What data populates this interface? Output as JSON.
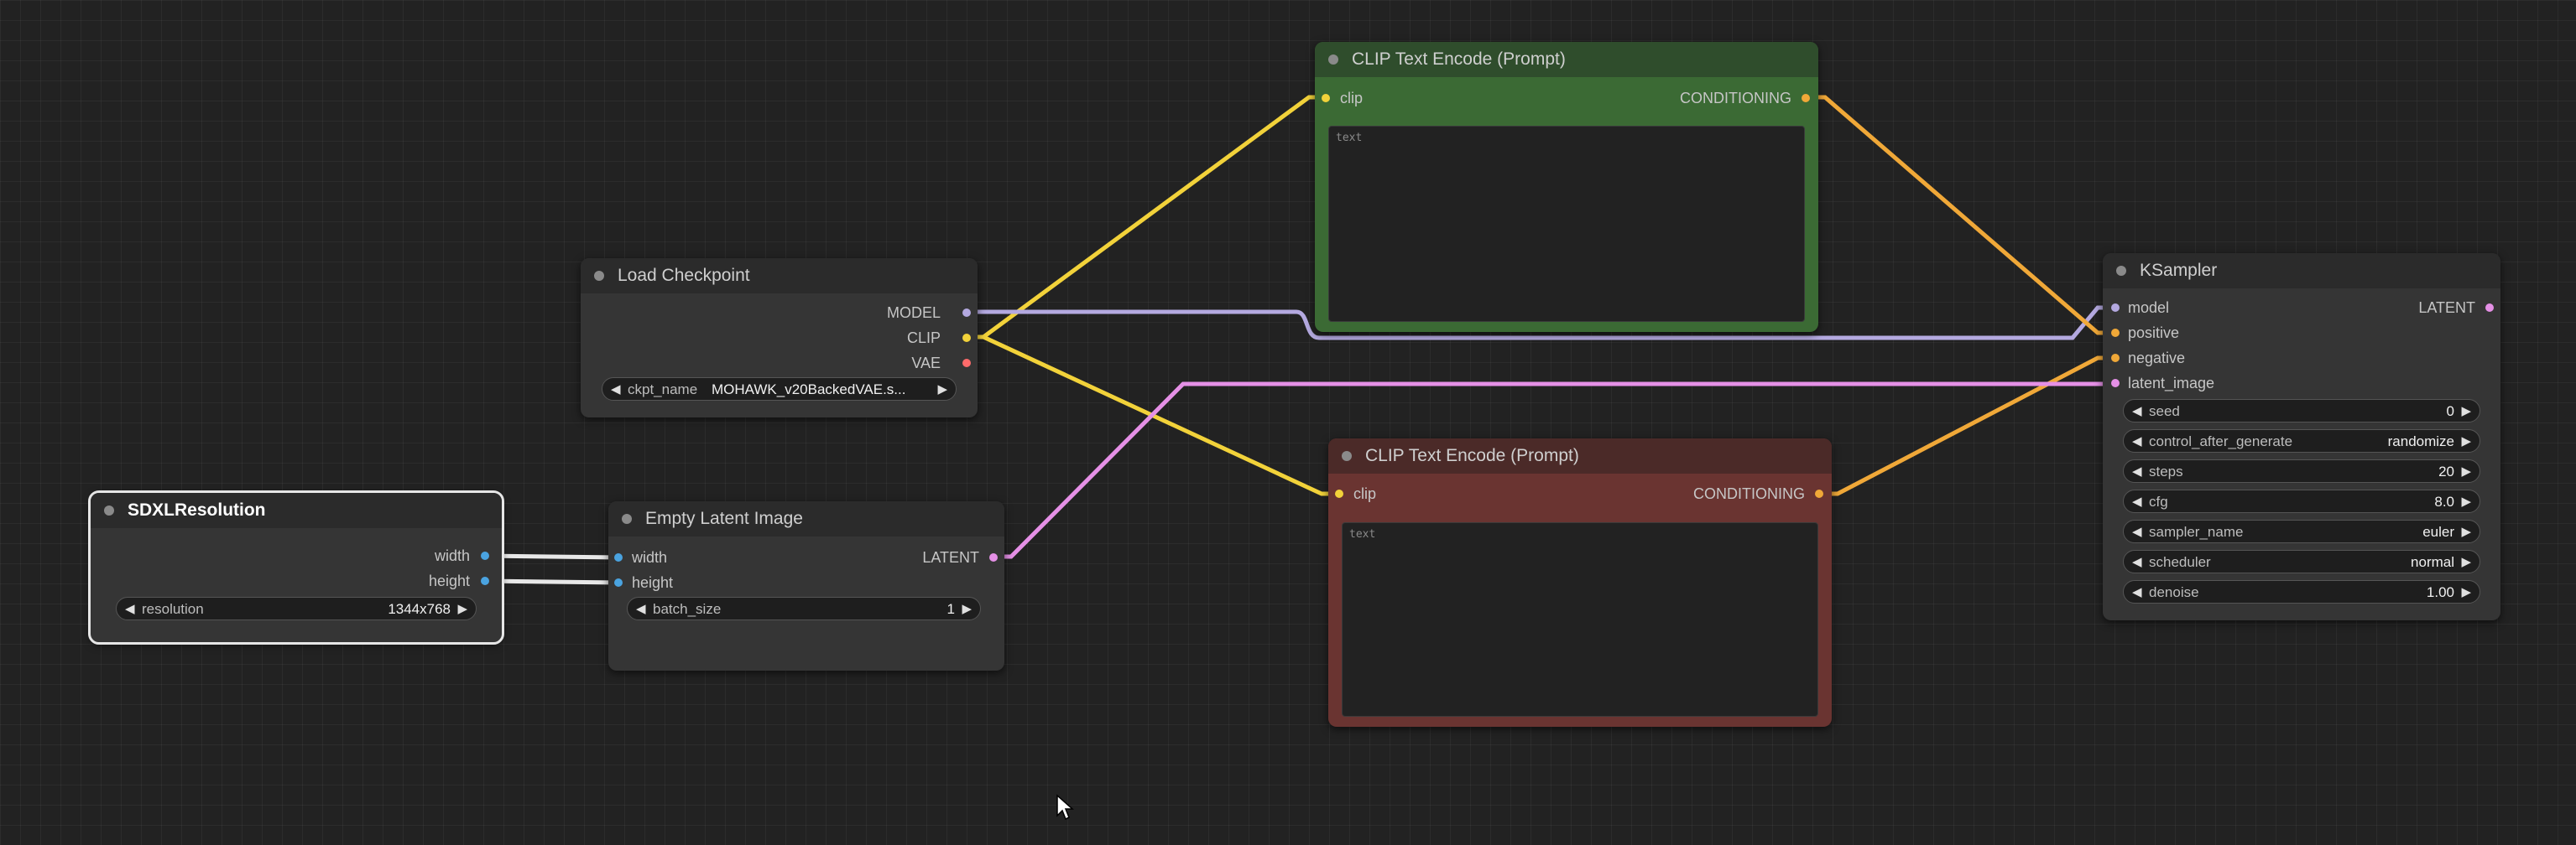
{
  "colors": {
    "model": "#b4a9e0",
    "clip": "#f2d23a",
    "vae": "#ff6b6b",
    "conditioning": "#f0a838",
    "latent": "#e590e6",
    "int": "#4aa3e0",
    "positive_header": "#2f4d2c",
    "positive_body": "#3b6a34",
    "negative_header": "#4b2a28",
    "negative_body": "#6a3431"
  },
  "nodes": {
    "load_checkpoint": {
      "title": "Load Checkpoint",
      "outputs": [
        "MODEL",
        "CLIP",
        "VAE"
      ],
      "widget": {
        "label": "ckpt_name",
        "value": "MOHAWK_v20BackedVAE.s..."
      }
    },
    "sdxl_resolution": {
      "title": "SDXLResolution",
      "outputs": [
        "width",
        "height"
      ],
      "widget": {
        "label": "resolution",
        "value": "1344x768"
      }
    },
    "empty_latent": {
      "title": "Empty Latent Image",
      "inputs": [
        "width",
        "height"
      ],
      "output": "LATENT",
      "widget": {
        "label": "batch_size",
        "value": "1"
      }
    },
    "clip_positive": {
      "title": "CLIP Text Encode (Prompt)",
      "input": "clip",
      "output": "CONDITIONING",
      "placeholder": "text"
    },
    "clip_negative": {
      "title": "CLIP Text Encode (Prompt)",
      "input": "clip",
      "output": "CONDITIONING",
      "placeholder": "text"
    },
    "ksampler": {
      "title": "KSampler",
      "inputs": [
        "model",
        "positive",
        "negative",
        "latent_image"
      ],
      "output": "LATENT",
      "widgets": [
        {
          "label": "seed",
          "value": "0"
        },
        {
          "label": "control_after_generate",
          "value": "randomize"
        },
        {
          "label": "steps",
          "value": "20"
        },
        {
          "label": "cfg",
          "value": "8.0"
        },
        {
          "label": "sampler_name",
          "value": "euler"
        },
        {
          "label": "scheduler",
          "value": "normal"
        },
        {
          "label": "denoise",
          "value": "1.00"
        }
      ]
    }
  }
}
